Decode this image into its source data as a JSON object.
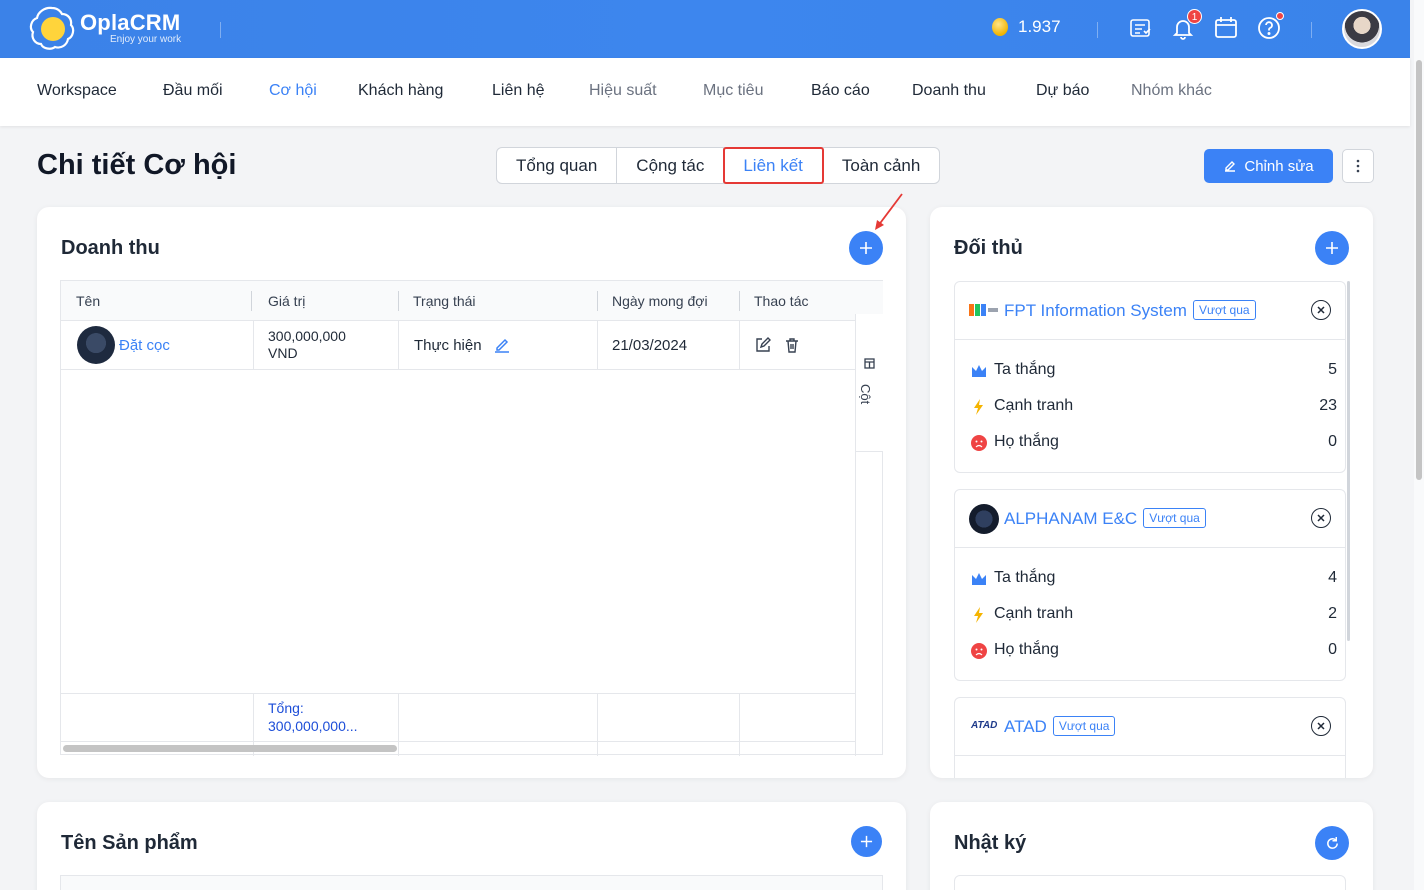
{
  "app": {
    "name": "OplaCRM",
    "slogan": "Enjoy your work",
    "coins": "1.937",
    "notification_count": "1"
  },
  "nav": [
    {
      "label": "Workspace",
      "state": "normal"
    },
    {
      "label": "Đầu mối",
      "state": "normal"
    },
    {
      "label": "Cơ hội",
      "state": "active"
    },
    {
      "label": "Khách hàng",
      "state": "normal"
    },
    {
      "label": "Liên hệ",
      "state": "normal"
    },
    {
      "label": "Hiệu suất",
      "state": "muted"
    },
    {
      "label": "Mục tiêu",
      "state": "muted"
    },
    {
      "label": "Báo cáo",
      "state": "normal"
    },
    {
      "label": "Doanh thu",
      "state": "normal"
    },
    {
      "label": "Dự báo",
      "state": "normal"
    },
    {
      "label": "Nhóm khác",
      "state": "muted"
    }
  ],
  "page": {
    "title": "Chi tiết Cơ hội",
    "tabs": [
      "Tổng quan",
      "Cộng tác",
      "Liên kết",
      "Toàn cảnh"
    ],
    "active_tab": "Liên kết",
    "edit_label": "Chỉnh sửa"
  },
  "revenue": {
    "title": "Doanh thu",
    "columns": [
      "Tên",
      "Giá trị",
      "Trạng thái",
      "Ngày mong đợi",
      "Thao tác"
    ],
    "rows": [
      {
        "name": "Đặt cọc",
        "value_line1": "300,000,000",
        "value_line2": "VND",
        "status": "Thực hiện",
        "date": "21/03/2024"
      }
    ],
    "total_label": "Tổng:",
    "total_value": "300,000,000...",
    "columns_toggle": "Cột"
  },
  "competitors": {
    "title": "Đối thủ",
    "tag": "Vượt qua",
    "labels": {
      "win": "Ta thắng",
      "compete": "Cạnh tranh",
      "lose": "Họ thắng"
    },
    "items": [
      {
        "name": "FPT Information System",
        "win": "5",
        "compete": "23",
        "lose": "0"
      },
      {
        "name": "ALPHANAM E&C",
        "win": "4",
        "compete": "2",
        "lose": "0"
      },
      {
        "name": "ATAD"
      }
    ],
    "atad_logo": "ATAD"
  },
  "products": {
    "title": "Tên Sản phẩm"
  },
  "log": {
    "title": "Nhật ký"
  },
  "colors": {
    "primary": "#3b82f6",
    "header": "#3d86ee",
    "highlight": "#e53935"
  }
}
